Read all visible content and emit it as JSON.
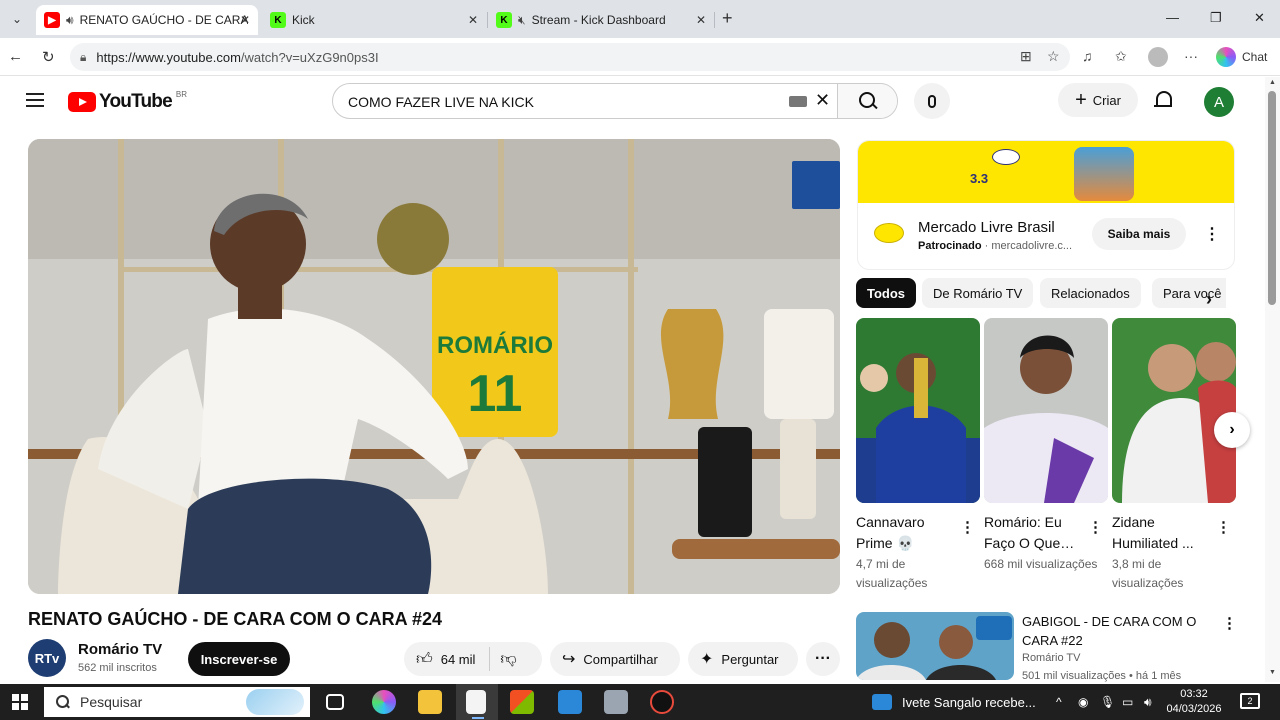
{
  "browser": {
    "tabs": [
      {
        "title": "RENATO GAÚCHO - DE CARA",
        "favicon": "youtube-favicon",
        "audio": "speaker-icon",
        "active": true
      },
      {
        "title": "Kick",
        "favicon": "kick-favicon",
        "active": false
      },
      {
        "title": "Stream - Kick Dashboard",
        "favicon": "kick-favicon",
        "audio": "muted-icon",
        "active": false
      }
    ],
    "url_host": "https://www.youtube.com",
    "url_path": "/watch?v=uXzG9n0ps3I",
    "copilot_label": "Chat"
  },
  "youtube": {
    "logo_text": "YouTube",
    "country_code": "BR",
    "search_query": "COMO FAZER LIVE NA KICK",
    "create_label": "Criar",
    "user_initial": "A"
  },
  "video": {
    "title": "RENATO GAÚCHO - DE CARA COM O CARA #24",
    "channel_name": "Romário TV",
    "channel_subs": "562 mil inscritos",
    "subscribe_label": "Inscrever-se",
    "likes": "64 mil",
    "share_label": "Compartilhar",
    "ask_label": "Perguntar",
    "jersey_name": "ROMÁRIO",
    "jersey_number": "11"
  },
  "ad": {
    "banner_text": "3.3",
    "title": "Mercado Livre Brasil",
    "sponsored": "Patrocinado",
    "domain": "mercadolivre.c...",
    "cta": "Saiba mais"
  },
  "chips": [
    "Todos",
    "De Romário TV",
    "Relacionados",
    "Para você"
  ],
  "shorts": [
    {
      "title": "Cannavaro Prime 💀",
      "views": "4,7 mi de visualizações"
    },
    {
      "title": "Romário: Eu Faço O Que…",
      "views": "668 mil visualizações"
    },
    {
      "title": "Zidane Humiliated ...",
      "views": "3,8 mi de visualizações"
    }
  ],
  "recommended": [
    {
      "title": "GABIGOL - DE CARA COM O CARA #22",
      "channel": "Romário TV",
      "meta": "501 mil visualizações • há 1 mês"
    }
  ],
  "taskbar": {
    "search_placeholder": "Pesquisar",
    "news": "Ivete Sangalo recebe...",
    "time": "03:32",
    "date": "04/03/2026",
    "notifications": "2"
  },
  "colors": {
    "youtube_red": "#ff0000",
    "kick_green": "#53fc18",
    "ad_yellow": "#ffe600",
    "taskbar": "#1f1f1f"
  }
}
